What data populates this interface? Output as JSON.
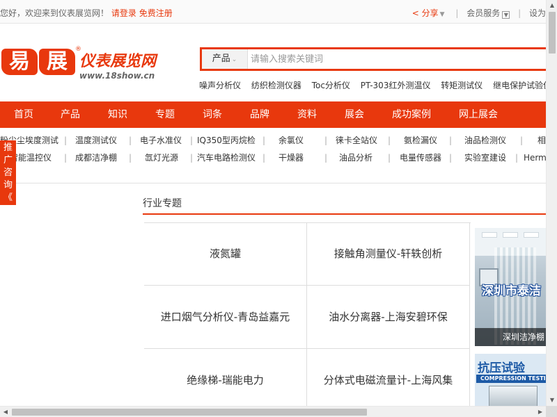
{
  "topbar": {
    "welcome": "您好，欢迎来到仪表展览网！",
    "login": "请登录",
    "register": "免费注册",
    "share": "分享",
    "member": "会员服务",
    "settings": "设为"
  },
  "logo": {
    "char1": "易",
    "char2": "展",
    "reg": "®",
    "title": "仪表展览网",
    "url": "www.18show.cn"
  },
  "search": {
    "category": "产品",
    "placeholder": "请输入搜索关键词"
  },
  "hotwords": [
    "噪声分析仪",
    "纺织检测仪器",
    "Toc分析仪",
    "PT-303红外测温仪",
    "转矩测试仪",
    "继电保护试验仪"
  ],
  "nav": [
    "首页",
    "产品",
    "知识",
    "专题",
    "词条",
    "品牌",
    "资料",
    "展会",
    "成功案例",
    "网上展会"
  ],
  "keywords_row1": [
    "粉尘尘埃度测试",
    "温度测试仪",
    "电子水准仪",
    "IQ350型丙烷检",
    "余氯仪",
    "徕卡全站仪",
    "氨检漏仪",
    "油品检测仪",
    "相"
  ],
  "keywords_row2": [
    "智能温控仪",
    "成都洁净棚",
    "氙灯光源",
    "汽车电路检测仪",
    "干燥器",
    "油品分析",
    "电量传感器",
    "实验室建设",
    "Herm"
  ],
  "sidetag": [
    "推",
    "广",
    "咨",
    "询",
    "《"
  ],
  "section": {
    "title": "行业专题",
    "topics": [
      "液氮罐",
      "接触角测量仪-轩轶创析",
      "进口烟气分析仪-青岛益嘉元",
      "油水分离器-上海安碧环保",
      "绝缘梯-瑞能电力",
      "分体式电磁流量计-上海风集"
    ]
  },
  "ads": {
    "ad1_brand": "深圳市泰洁",
    "ad1_caption": "深圳洁净棚",
    "ad2_title": "抗压试验",
    "ad2_subtitle": "COMPRESSION TESTING M"
  },
  "scroll_icons": {
    "up": "▲",
    "down": "▼",
    "left": "◀",
    "right": "▶"
  }
}
